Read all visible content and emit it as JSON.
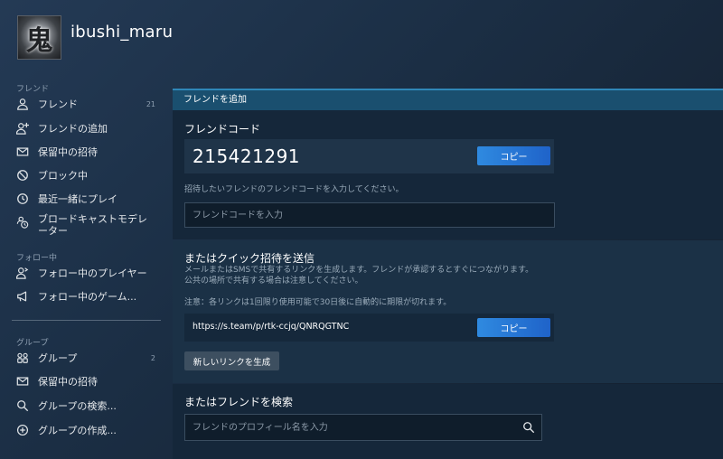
{
  "profile": {
    "username": "ibushi_maru",
    "avatar_glyph": "鬼"
  },
  "sidebar": {
    "sections": {
      "friends": "フレンド",
      "following": "フォロー中",
      "groups": "グループ"
    },
    "items": [
      {
        "label": "フレンド",
        "count": "21",
        "icon": "person-icon"
      },
      {
        "label": "フレンドの追加",
        "icon": "person-add-icon"
      },
      {
        "label": "保留中の招待",
        "icon": "envelope-icon"
      },
      {
        "label": "ブロック中",
        "icon": "block-icon"
      },
      {
        "label": "最近一緒にプレイ",
        "icon": "clock-icon"
      },
      {
        "label": "ブロードキャストモデレーター",
        "icon": "broadcast-moderator-icon"
      },
      {
        "label": "フォロー中のプレイヤー",
        "icon": "person-follow-icon"
      },
      {
        "label": "フォロー中のゲーム...",
        "icon": "megaphone-icon"
      },
      {
        "label": "グループ",
        "count": "2",
        "icon": "group-icon"
      },
      {
        "label": "保留中の招待",
        "icon": "envelope-icon"
      },
      {
        "label": "グループの検索...",
        "icon": "search-icon"
      },
      {
        "label": "グループの作成...",
        "icon": "plus-circle-icon"
      }
    ]
  },
  "main": {
    "title": "フレンドを追加",
    "friend_code": {
      "heading": "フレンドコード",
      "code": "215421291",
      "copy_label": "コピー",
      "hint": "招待したいフレンドのフレンドコードを入力してください。",
      "input_placeholder": "フレンドコードを入力"
    },
    "quick_invite": {
      "heading": "またはクイック招待を送信",
      "desc_line1": "メールまたはSMSで共有するリンクを生成します。フレンドが承認するとすぐにつながります。",
      "desc_line2": "公共の場所で共有する場合は注意してください。",
      "note": "注意：各リンクは1回限り使用可能で30日後に自動的に期限が切れます。",
      "link": "https://s.team/p/rtk-ccjq/QNRQGTNC",
      "copy_label": "コピー",
      "new_link_label": "新しいリンクを生成"
    },
    "search": {
      "heading": "またはフレンドを検索",
      "placeholder": "フレンドのプロフィール名を入力"
    }
  },
  "colors": {
    "accent_bar": "#1a4f6f",
    "copy_button": "#2f8ae0",
    "background": "#1a2c42"
  }
}
